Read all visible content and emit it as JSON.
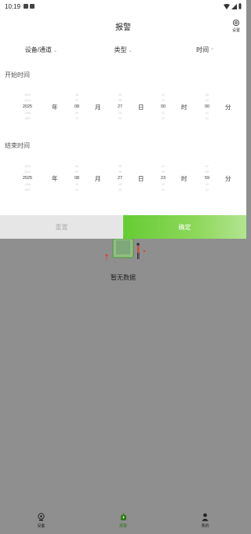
{
  "status_bar": {
    "time": "10:19"
  },
  "header": {
    "title": "报警",
    "settings_label": "设置"
  },
  "filters": [
    {
      "label": "设备/通道",
      "arrow": "⌄"
    },
    {
      "label": "类型",
      "arrow": "⌄"
    },
    {
      "label": "时间",
      "arrow": "⌃"
    }
  ],
  "start": {
    "label": "开始时间",
    "year": {
      "above2": "2023",
      "above1": "2024",
      "selected": "2025",
      "below1": "1996",
      "below2": "1997"
    },
    "month": {
      "above2": "06",
      "above1": "07",
      "selected": "08",
      "below1": "09",
      "below2": "10"
    },
    "day": {
      "above2": "25",
      "above1": "26",
      "selected": "27",
      "below1": "28",
      "below2": "29"
    },
    "hour": {
      "above2": "22",
      "above1": "23",
      "selected": "00",
      "below1": "01",
      "below2": "02"
    },
    "minute": {
      "above2": "58",
      "above1": "59",
      "selected": "00",
      "below1": "01",
      "below2": "02"
    },
    "units": {
      "year": "年",
      "month": "月",
      "day": "日",
      "hour": "时",
      "minute": "分"
    }
  },
  "end": {
    "label": "结束时间",
    "year": {
      "above2": "2023",
      "above1": "2024",
      "selected": "2025",
      "below1": "1996",
      "below2": "1997"
    },
    "month": {
      "above2": "06",
      "above1": "07",
      "selected": "08",
      "below1": "09",
      "below2": "10"
    },
    "day": {
      "above2": "25",
      "above1": "26",
      "selected": "27",
      "below1": "28",
      "below2": "29"
    },
    "hour": {
      "above2": "21",
      "above1": "22",
      "selected": "23",
      "below1": "00",
      "below2": "01"
    },
    "minute": {
      "above2": "57",
      "above1": "58",
      "selected": "59",
      "below1": "00",
      "below2": "01"
    },
    "units": {
      "year": "年",
      "month": "月",
      "day": "日",
      "hour": "时",
      "minute": "分"
    }
  },
  "buttons": {
    "reset": "重置",
    "confirm": "确定"
  },
  "empty_text": "暂无数据",
  "nav": [
    {
      "label": "设备",
      "icon": "camera-icon"
    },
    {
      "label": "报警",
      "icon": "alarm-bell-icon"
    },
    {
      "label": "我的",
      "icon": "person-icon"
    }
  ],
  "colors": {
    "accent": "#66cc33",
    "overlay": "#8f8f8f"
  }
}
